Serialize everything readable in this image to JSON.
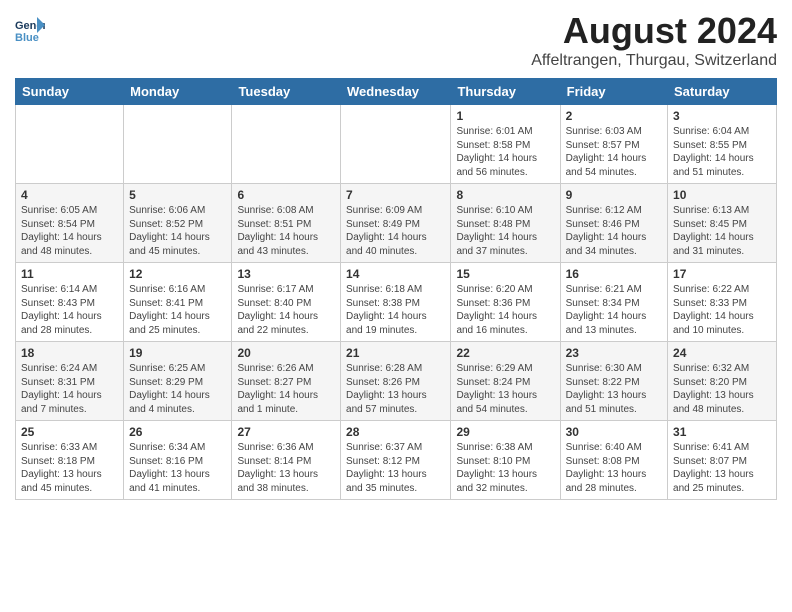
{
  "header": {
    "logo_line1": "General",
    "logo_line2": "Blue",
    "title": "August 2024",
    "subtitle": "Affeltrangen, Thurgau, Switzerland"
  },
  "calendar": {
    "days_of_week": [
      "Sunday",
      "Monday",
      "Tuesday",
      "Wednesday",
      "Thursday",
      "Friday",
      "Saturday"
    ],
    "weeks": [
      [
        {
          "day": "",
          "detail": ""
        },
        {
          "day": "",
          "detail": ""
        },
        {
          "day": "",
          "detail": ""
        },
        {
          "day": "",
          "detail": ""
        },
        {
          "day": "1",
          "detail": "Sunrise: 6:01 AM\nSunset: 8:58 PM\nDaylight: 14 hours\nand 56 minutes."
        },
        {
          "day": "2",
          "detail": "Sunrise: 6:03 AM\nSunset: 8:57 PM\nDaylight: 14 hours\nand 54 minutes."
        },
        {
          "day": "3",
          "detail": "Sunrise: 6:04 AM\nSunset: 8:55 PM\nDaylight: 14 hours\nand 51 minutes."
        }
      ],
      [
        {
          "day": "4",
          "detail": "Sunrise: 6:05 AM\nSunset: 8:54 PM\nDaylight: 14 hours\nand 48 minutes."
        },
        {
          "day": "5",
          "detail": "Sunrise: 6:06 AM\nSunset: 8:52 PM\nDaylight: 14 hours\nand 45 minutes."
        },
        {
          "day": "6",
          "detail": "Sunrise: 6:08 AM\nSunset: 8:51 PM\nDaylight: 14 hours\nand 43 minutes."
        },
        {
          "day": "7",
          "detail": "Sunrise: 6:09 AM\nSunset: 8:49 PM\nDaylight: 14 hours\nand 40 minutes."
        },
        {
          "day": "8",
          "detail": "Sunrise: 6:10 AM\nSunset: 8:48 PM\nDaylight: 14 hours\nand 37 minutes."
        },
        {
          "day": "9",
          "detail": "Sunrise: 6:12 AM\nSunset: 8:46 PM\nDaylight: 14 hours\nand 34 minutes."
        },
        {
          "day": "10",
          "detail": "Sunrise: 6:13 AM\nSunset: 8:45 PM\nDaylight: 14 hours\nand 31 minutes."
        }
      ],
      [
        {
          "day": "11",
          "detail": "Sunrise: 6:14 AM\nSunset: 8:43 PM\nDaylight: 14 hours\nand 28 minutes."
        },
        {
          "day": "12",
          "detail": "Sunrise: 6:16 AM\nSunset: 8:41 PM\nDaylight: 14 hours\nand 25 minutes."
        },
        {
          "day": "13",
          "detail": "Sunrise: 6:17 AM\nSunset: 8:40 PM\nDaylight: 14 hours\nand 22 minutes."
        },
        {
          "day": "14",
          "detail": "Sunrise: 6:18 AM\nSunset: 8:38 PM\nDaylight: 14 hours\nand 19 minutes."
        },
        {
          "day": "15",
          "detail": "Sunrise: 6:20 AM\nSunset: 8:36 PM\nDaylight: 14 hours\nand 16 minutes."
        },
        {
          "day": "16",
          "detail": "Sunrise: 6:21 AM\nSunset: 8:34 PM\nDaylight: 14 hours\nand 13 minutes."
        },
        {
          "day": "17",
          "detail": "Sunrise: 6:22 AM\nSunset: 8:33 PM\nDaylight: 14 hours\nand 10 minutes."
        }
      ],
      [
        {
          "day": "18",
          "detail": "Sunrise: 6:24 AM\nSunset: 8:31 PM\nDaylight: 14 hours\nand 7 minutes."
        },
        {
          "day": "19",
          "detail": "Sunrise: 6:25 AM\nSunset: 8:29 PM\nDaylight: 14 hours\nand 4 minutes."
        },
        {
          "day": "20",
          "detail": "Sunrise: 6:26 AM\nSunset: 8:27 PM\nDaylight: 14 hours\nand 1 minute."
        },
        {
          "day": "21",
          "detail": "Sunrise: 6:28 AM\nSunset: 8:26 PM\nDaylight: 13 hours\nand 57 minutes."
        },
        {
          "day": "22",
          "detail": "Sunrise: 6:29 AM\nSunset: 8:24 PM\nDaylight: 13 hours\nand 54 minutes."
        },
        {
          "day": "23",
          "detail": "Sunrise: 6:30 AM\nSunset: 8:22 PM\nDaylight: 13 hours\nand 51 minutes."
        },
        {
          "day": "24",
          "detail": "Sunrise: 6:32 AM\nSunset: 8:20 PM\nDaylight: 13 hours\nand 48 minutes."
        }
      ],
      [
        {
          "day": "25",
          "detail": "Sunrise: 6:33 AM\nSunset: 8:18 PM\nDaylight: 13 hours\nand 45 minutes."
        },
        {
          "day": "26",
          "detail": "Sunrise: 6:34 AM\nSunset: 8:16 PM\nDaylight: 13 hours\nand 41 minutes."
        },
        {
          "day": "27",
          "detail": "Sunrise: 6:36 AM\nSunset: 8:14 PM\nDaylight: 13 hours\nand 38 minutes."
        },
        {
          "day": "28",
          "detail": "Sunrise: 6:37 AM\nSunset: 8:12 PM\nDaylight: 13 hours\nand 35 minutes."
        },
        {
          "day": "29",
          "detail": "Sunrise: 6:38 AM\nSunset: 8:10 PM\nDaylight: 13 hours\nand 32 minutes."
        },
        {
          "day": "30",
          "detail": "Sunrise: 6:40 AM\nSunset: 8:08 PM\nDaylight: 13 hours\nand 28 minutes."
        },
        {
          "day": "31",
          "detail": "Sunrise: 6:41 AM\nSunset: 8:07 PM\nDaylight: 13 hours\nand 25 minutes."
        }
      ]
    ]
  }
}
